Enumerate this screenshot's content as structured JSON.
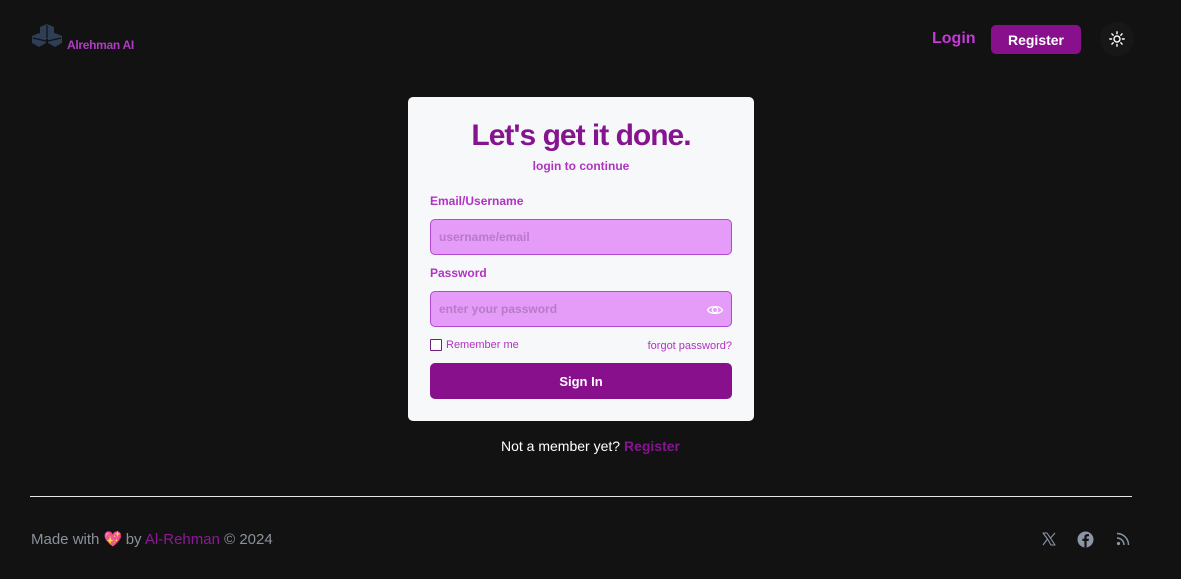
{
  "header": {
    "brand": "Alrehman AI",
    "nav_login": "Login",
    "nav_register": "Register"
  },
  "card": {
    "title": "Let's get it done.",
    "subtitle": "login to continue",
    "email_label": "Email/Username",
    "email_placeholder": "username/email",
    "email_value": "",
    "password_label": "Password",
    "password_placeholder": "enter your password",
    "password_value": "",
    "remember_label": "Remember me",
    "remember_checked": false,
    "forgot_link": "forgot password?",
    "signin_button": "Sign In"
  },
  "below_card": {
    "prompt": "Not a member yet?",
    "register_link": "Register"
  },
  "footer": {
    "made_with": "Made with",
    "heart_emoji": "💖",
    "by": "by",
    "author": "Al-Rehman",
    "copyright": "© 2024"
  },
  "icons": {
    "logo": "logo-icon",
    "theme": "sun-icon",
    "password_toggle": "eye-icon",
    "social": [
      "x-icon",
      "facebook-icon",
      "rss-icon"
    ]
  },
  "colors": {
    "background": "#121212",
    "brand": "#88108d",
    "accent": "#c53ad6",
    "input_bg": "#e59bf8",
    "card_bg": "#f7f8fa"
  }
}
